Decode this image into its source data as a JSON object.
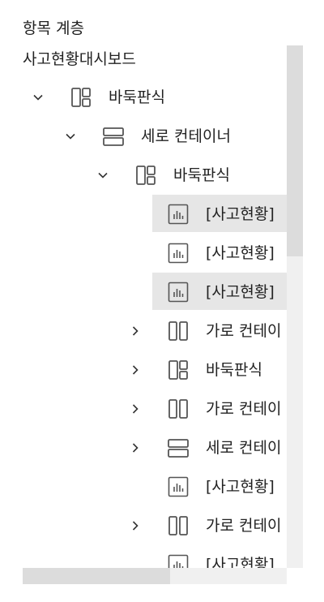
{
  "panel": {
    "title": "항목 계층"
  },
  "tree": {
    "root_label": "사고현황대시보드",
    "nodes": [
      {
        "label": "바둑판식",
        "icon": "grid-layout-icon",
        "expand": "expanded",
        "selected": false
      },
      {
        "label": "세로 컨테이너",
        "icon": "vertical-container-icon",
        "expand": "expanded",
        "selected": false
      },
      {
        "label": "바둑판식",
        "icon": "grid-layout-icon",
        "expand": "expanded",
        "selected": false
      },
      {
        "label": "[사고현황]",
        "icon": "chart-icon",
        "expand": "none",
        "selected": true
      },
      {
        "label": "[사고현황]",
        "icon": "chart-icon",
        "expand": "none",
        "selected": false
      },
      {
        "label": "[사고현황]",
        "icon": "chart-icon",
        "expand": "none",
        "selected": true
      },
      {
        "label": "가로 컨테이",
        "icon": "horizontal-container-icon",
        "expand": "collapsed",
        "selected": false
      },
      {
        "label": "바둑판식",
        "icon": "grid-layout-icon",
        "expand": "collapsed",
        "selected": false
      },
      {
        "label": "가로 컨테이",
        "icon": "horizontal-container-icon",
        "expand": "collapsed",
        "selected": false
      },
      {
        "label": "세로 컨테이",
        "icon": "vertical-container-icon",
        "expand": "collapsed",
        "selected": false
      },
      {
        "label": "[사고현황]",
        "icon": "chart-icon",
        "expand": "none",
        "selected": false
      },
      {
        "label": "가로 컨테이",
        "icon": "horizontal-container-icon",
        "expand": "collapsed",
        "selected": false
      },
      {
        "label": "[사고현황]",
        "icon": "chart-icon",
        "expand": "none",
        "selected": false
      }
    ]
  }
}
